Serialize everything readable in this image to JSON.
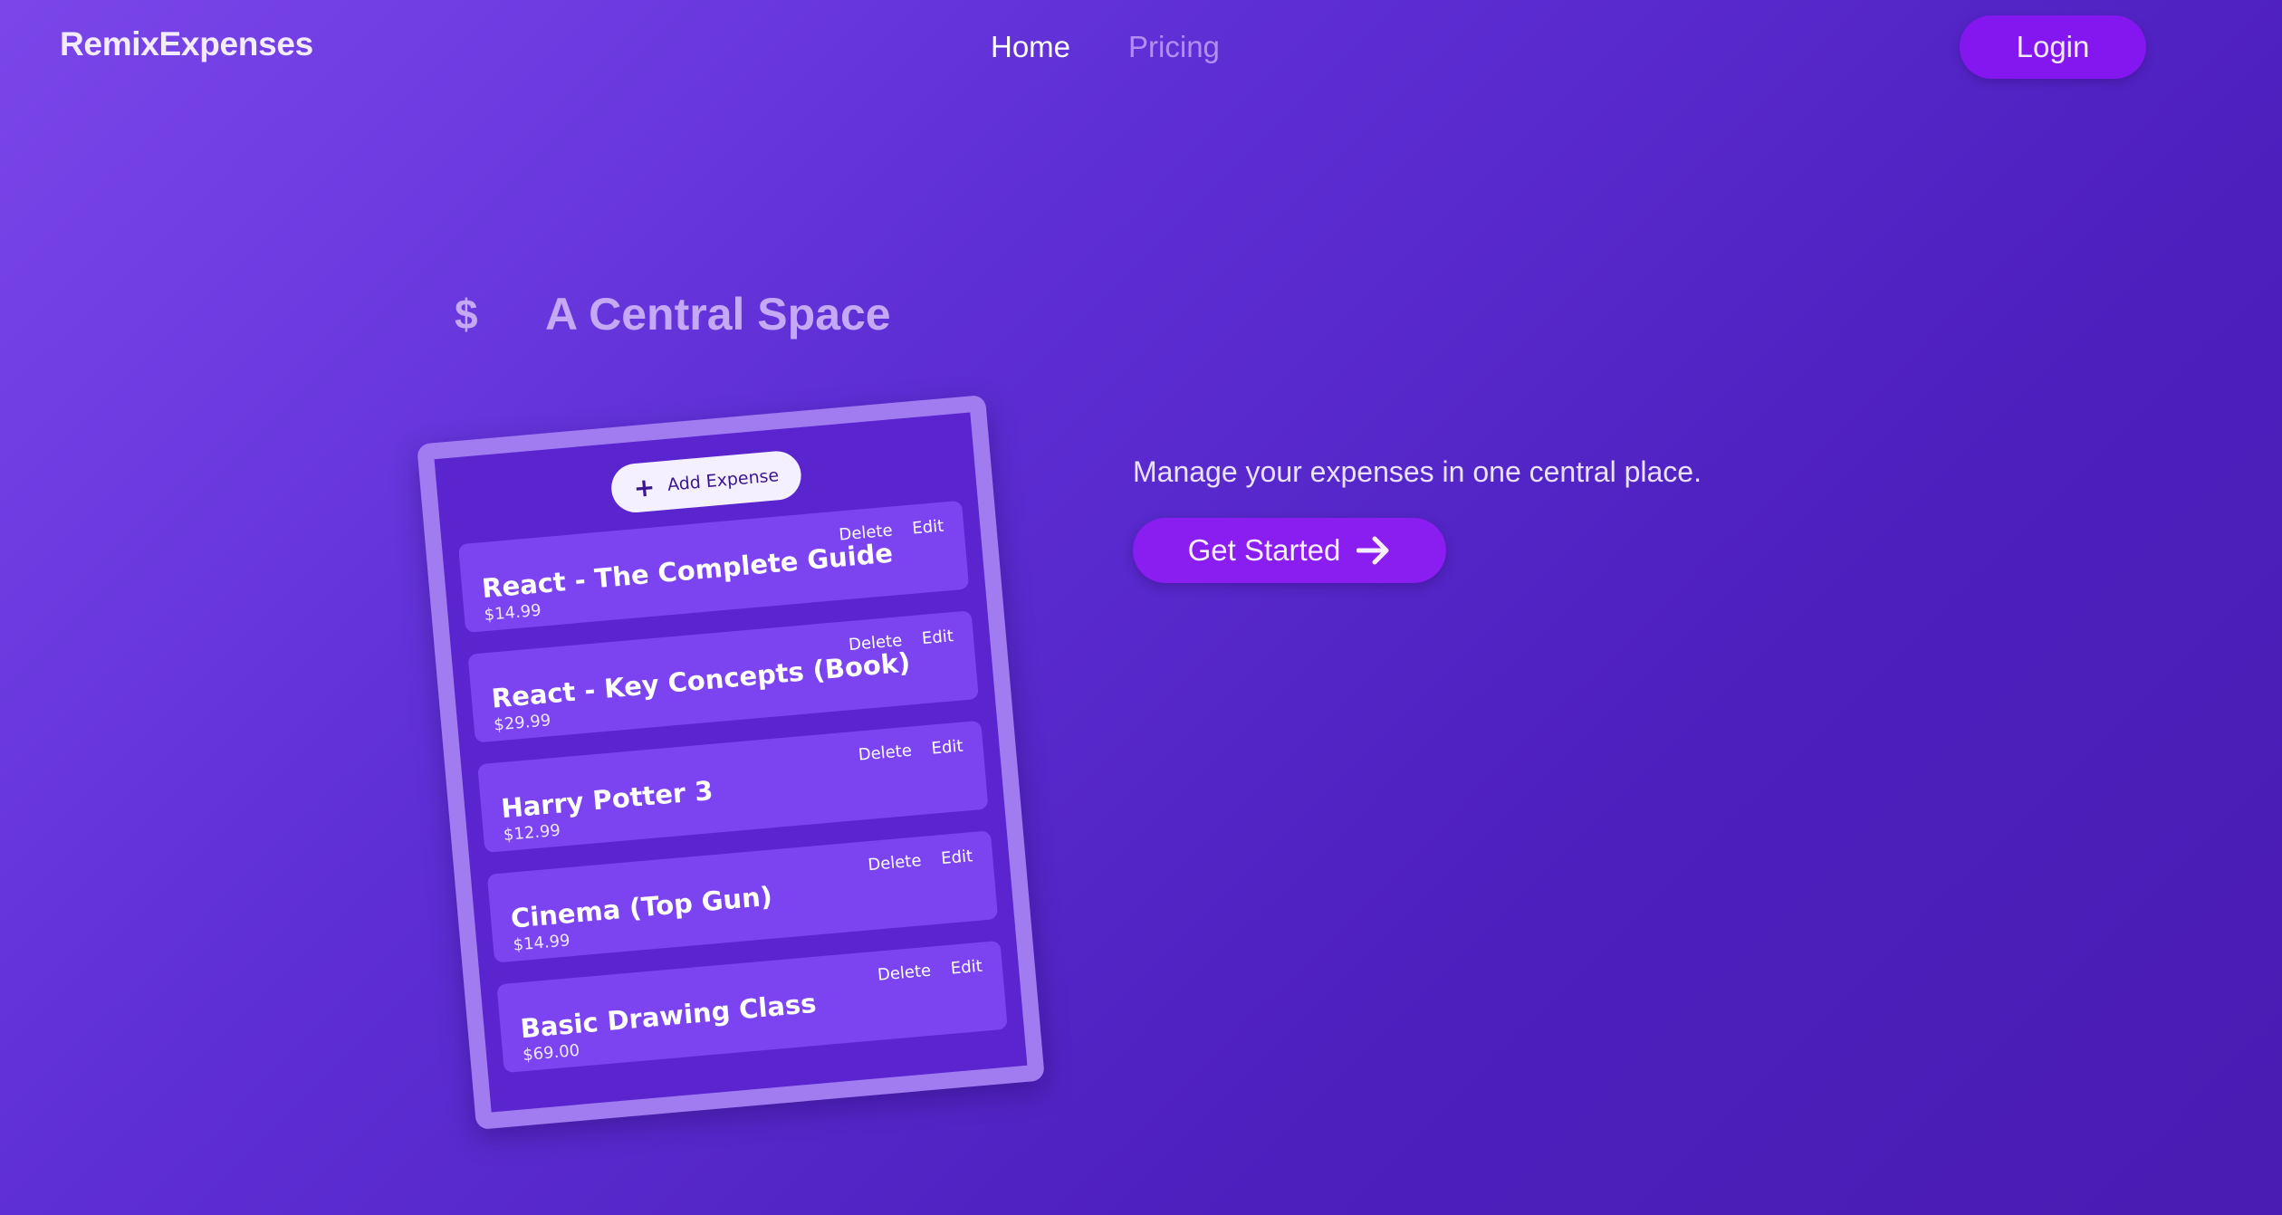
{
  "header": {
    "logo": "RemixExpenses",
    "nav": [
      {
        "label": "Home"
      },
      {
        "label": "Pricing"
      }
    ],
    "login_label": "Login"
  },
  "hero": {
    "icon": "dollar-icon",
    "icon_glyph": "$",
    "title": "A Central Space",
    "tagline": "Manage your expenses in one central place.",
    "cta_label": "Get Started"
  },
  "card": {
    "add_label": "Add Expense",
    "delete_label": "Delete",
    "edit_label": "Edit",
    "expenses": [
      {
        "title": "React - The Complete Guide",
        "price": "$14.99"
      },
      {
        "title": "React - Key Concepts (Book)",
        "price": "$29.99"
      },
      {
        "title": "Harry Potter 3",
        "price": "$12.99"
      },
      {
        "title": "Cinema (Top Gun)",
        "price": "$14.99"
      },
      {
        "title": "Basic Drawing Class",
        "price": "$69.00"
      }
    ]
  },
  "colors": {
    "background_start": "#7a46ea",
    "background_end": "#4a1cb3",
    "accent_button": "#8417ef",
    "expense_item": "#7b44f0"
  }
}
